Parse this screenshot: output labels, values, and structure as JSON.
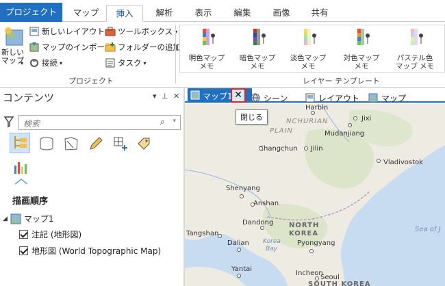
{
  "ribbon_tabs": [
    "プロジェクト",
    "マップ",
    "挿入",
    "解析",
    "表示",
    "編集",
    "画像",
    "共有"
  ],
  "ribbon": {
    "new_map": "新しい\nマップ",
    "new_layout": "新しいレイアウト",
    "import_map": "マップのインポート",
    "connection": "接続",
    "toolbox": "ツールボックス",
    "add_folder": "フォルダーの追加",
    "task": "タスク",
    "project_group": "プロジェクト",
    "layer_template_group": "レイヤー テンプレート",
    "templates": [
      {
        "line1": "明色マップ",
        "line2": "メモ"
      },
      {
        "line1": "暗色マップ",
        "line2": "メモ"
      },
      {
        "line1": "淡色マップ",
        "line2": "メモ"
      },
      {
        "line1": "対色マップ",
        "line2": "メモ"
      },
      {
        "line1": "パステル色",
        "line2": "マップ メモ"
      }
    ]
  },
  "contents": {
    "title": "コンテンツ",
    "pin": "▾ ⊥ ✕",
    "search_placeholder": "検索",
    "draw_order_label": "描画順序",
    "map_name": "マップ1",
    "layers": [
      "注記 (地形図)",
      "地形図 (World Topographic Map)"
    ]
  },
  "view_tabs": {
    "map1": "マップ1",
    "scene": "シーン",
    "layout": "レイアウト",
    "map": "マップ"
  },
  "tooltip": "閉じる",
  "map_labels": {
    "harbin": "Harbin",
    "manchurian": "NCHURIAN",
    "plain": "PLAIN",
    "jixi": "Jixi",
    "mudanjiang": "Mudanjiang",
    "changchun": "Changchun",
    "jilin": "Jilin",
    "vladivostok": "Vladivostok",
    "shenyang": "Shenyang",
    "anshan": "Anshan",
    "dandong": "Dandong",
    "north": "NORTH",
    "korea": "KOREA",
    "tangshan": "Tangshan",
    "dalian": "Dalian",
    "korea_bay1": "Korea",
    "korea_bay2": "Bay",
    "pyongyang": "Pyongyang",
    "sea": "Sea of J",
    "yantai": "Yantai",
    "incheon": "Incheon",
    "seoul": "Seoul",
    "south_korea": "SOUTH KOREA"
  },
  "colors": {
    "accent": "#1f6fc2",
    "highlight": "#e0242c",
    "sea": "#c7dcf0",
    "land": "#f0ede4"
  }
}
